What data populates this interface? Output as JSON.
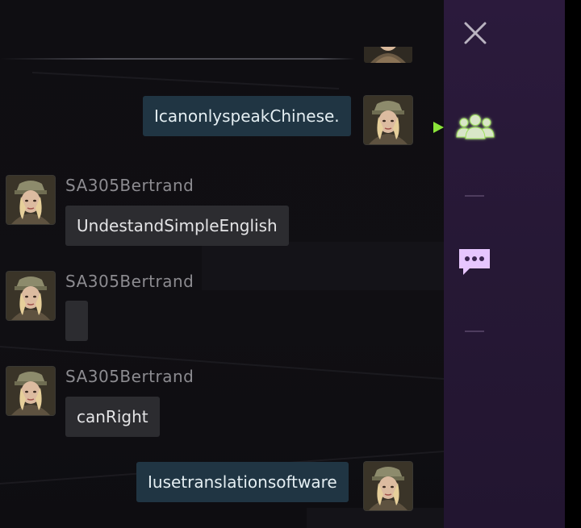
{
  "messages": [
    {
      "sender": "",
      "text": "IcanonlyspeakChinese.",
      "mine": true
    },
    {
      "sender": "SA305Bertrand",
      "text": "UndestandSimpleEnglish",
      "mine": false
    },
    {
      "sender": "SA305Bertrand",
      "text": "",
      "mine": false
    },
    {
      "sender": "SA305Bertrand",
      "text": "canRight",
      "mine": false
    },
    {
      "sender": "",
      "text": "Iusetranslationsoftware",
      "mine": true
    }
  ],
  "sidebar": {
    "icons": [
      "close-icon",
      "play-indicator-icon",
      "friends-group-icon",
      "chat-bubble-icon"
    ],
    "active_icon_color": "#9de05a",
    "chat_icon_color": "#e7c6ff"
  },
  "colors": {
    "my_bubble": "#203543",
    "other_bubble": "#2c2c30",
    "sidebar_bg": "#2b1a3c",
    "indicator": "#8be43a"
  }
}
